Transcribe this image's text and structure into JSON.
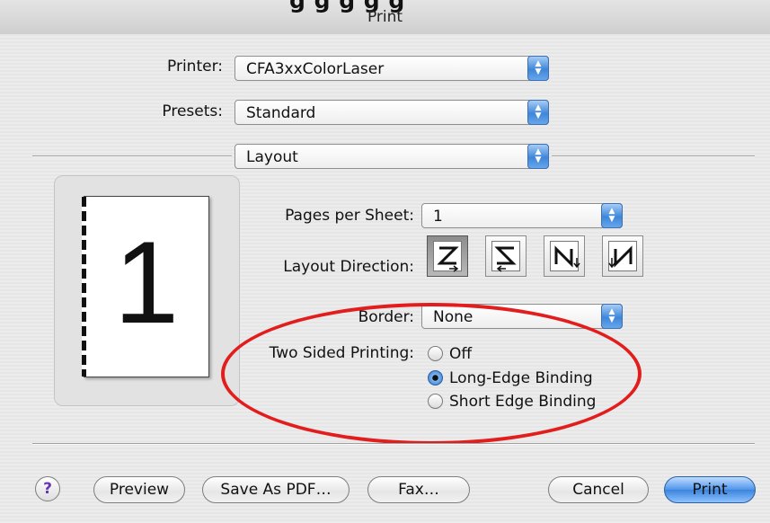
{
  "window": {
    "title": "Print",
    "title_cutoff_text": "g g g g g"
  },
  "printer": {
    "label": "Printer:",
    "value": "CFA3xxColorLaser"
  },
  "presets": {
    "label": "Presets:",
    "value": "Standard"
  },
  "pane": {
    "value": "Layout"
  },
  "preview": {
    "page_number": "1"
  },
  "layout": {
    "pages_per_sheet": {
      "label": "Pages per Sheet:",
      "value": "1"
    },
    "layout_direction": {
      "label": "Layout Direction:",
      "selected_index": 0,
      "options": [
        "z-order-icon",
        "reverse-z-order-icon",
        "n-order-icon",
        "reverse-n-order-icon"
      ]
    },
    "border": {
      "label": "Border:",
      "value": "None"
    },
    "two_sided": {
      "label": "Two Sided Printing:",
      "options": [
        "Off",
        "Long-Edge Binding",
        "Short Edge Binding"
      ],
      "selected_index": 1
    }
  },
  "buttons": {
    "help": "?",
    "preview": "Preview",
    "save_pdf": "Save As PDF…",
    "fax": "Fax…",
    "cancel": "Cancel",
    "print": "Print"
  },
  "colors": {
    "highlight_ellipse": "#e21d1d",
    "accent": "#3f86d9"
  }
}
